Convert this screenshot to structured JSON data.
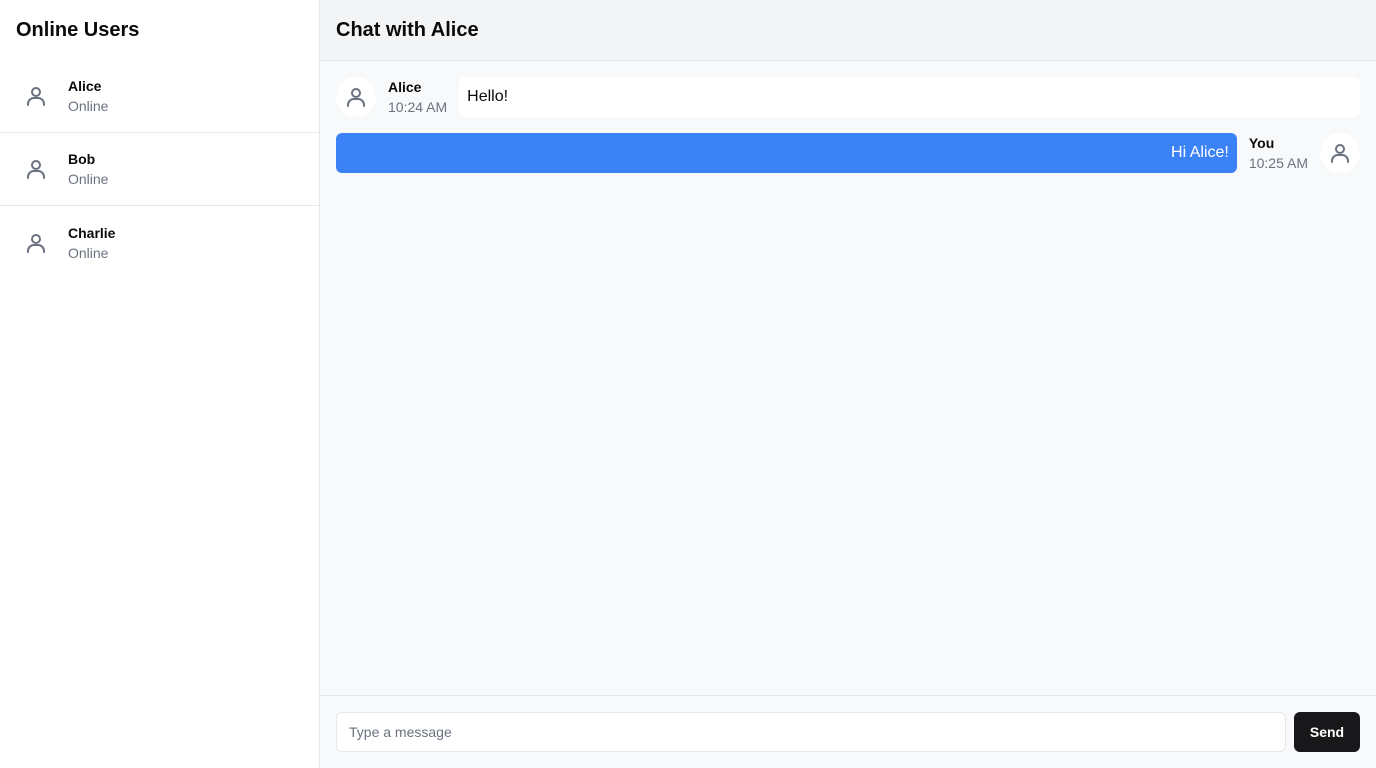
{
  "sidebar": {
    "title": "Online Users",
    "users": [
      {
        "name": "Alice",
        "status": "Online",
        "icon": "user-icon"
      },
      {
        "name": "Bob",
        "status": "Online",
        "icon": "user-icon"
      },
      {
        "name": "Charlie",
        "status": "Online",
        "icon": "user-icon"
      }
    ]
  },
  "chat": {
    "title": "Chat with Alice",
    "messages": [
      {
        "sender": "Alice",
        "time": "10:24 AM",
        "text": "Hello!",
        "direction": "incoming"
      },
      {
        "sender": "You",
        "time": "10:25 AM",
        "text": "Hi Alice!",
        "direction": "outgoing"
      }
    ]
  },
  "composer": {
    "placeholder": "Type a message",
    "value": "",
    "send_label": "Send"
  },
  "colors": {
    "accent": "#3b82f6",
    "send_button": "#18181b",
    "muted_text": "#6b7280",
    "border": "#e5e7eb"
  }
}
